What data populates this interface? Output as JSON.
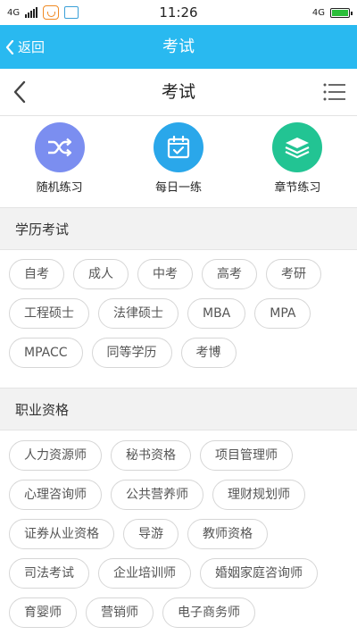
{
  "status_bar": {
    "network_left": "4G",
    "network_right": "4G",
    "time": "11:26"
  },
  "titlebar": {
    "back_label": "返回",
    "title": "考试"
  },
  "navbar": {
    "title": "考试"
  },
  "quick_actions": [
    {
      "label": "随机练习",
      "icon": "shuffle-icon",
      "color": "#7b8ef0"
    },
    {
      "label": "每日一练",
      "icon": "calendar-check-icon",
      "color": "#2aa7ea"
    },
    {
      "label": "章节练习",
      "icon": "layers-icon",
      "color": "#22c493"
    }
  ],
  "sections": [
    {
      "title": "学历考试",
      "tags": [
        "自考",
        "成人",
        "中考",
        "高考",
        "考研",
        "工程硕士",
        "法律硕士",
        "MBA",
        "MPA",
        "MPACC",
        "同等学历",
        "考博"
      ]
    },
    {
      "title": "职业资格",
      "tags": [
        "人力资源师",
        "秘书资格",
        "项目管理师",
        "心理咨询师",
        "公共营养师",
        "理财规划师",
        "证券从业资格",
        "导游",
        "教师资格",
        "司法考试",
        "企业培训师",
        "婚姻家庭咨询师",
        "育婴师",
        "营销师",
        "电子商务师"
      ]
    }
  ],
  "colors": {
    "titlebar_bg": "#29b9f0",
    "section_bg": "#f2f2f2"
  }
}
